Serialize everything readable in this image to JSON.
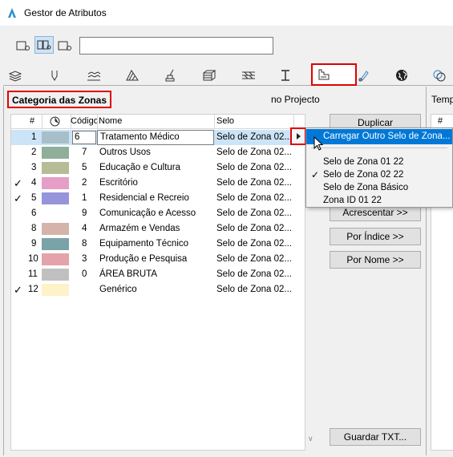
{
  "window": {
    "title": "Gestor de Atributos"
  },
  "toolbar": {
    "view_buttons": [
      "list-view-icon",
      "dual-view-icon",
      "single-view-icon"
    ],
    "search_value": ""
  },
  "tabs": [
    "stacks-icon",
    "pen-icon",
    "fill-icon",
    "surface-icon",
    "brush-icon",
    "composite-icon",
    "profile-icon",
    "column-icon",
    "zone-icon",
    "marker-icon",
    "globe-icon",
    "link-icon"
  ],
  "left_section": {
    "title": "Categoria das Zonas"
  },
  "project_label": "no Projecto",
  "template_label": "Temp",
  "table": {
    "headers": {
      "index": "#",
      "color": "",
      "code": "Código",
      "name": "Nome",
      "stamp": "Selo"
    },
    "rows": [
      {
        "index": "1",
        "checked": false,
        "color": "#a7bfc8",
        "code": "6",
        "name": "Tratamento Médico",
        "stamp": "Selo de Zona 02...",
        "selected": true
      },
      {
        "index": "2",
        "checked": false,
        "color": "#8faf9a",
        "code": "7",
        "name": "Outros Usos",
        "stamp": "Selo de Zona 02..."
      },
      {
        "index": "3",
        "checked": false,
        "color": "#b5bc96",
        "code": "5",
        "name": "Educação e Cultura",
        "stamp": "Selo de Zona 02..."
      },
      {
        "index": "4",
        "checked": true,
        "color": "#e59fc6",
        "code": "2",
        "name": "Escritório",
        "stamp": "Selo de Zona 02..."
      },
      {
        "index": "5",
        "checked": true,
        "color": "#9695db",
        "code": "1",
        "name": "Residencial e Recreio",
        "stamp": "Selo de Zona 02..."
      },
      {
        "index": "6",
        "checked": false,
        "color": "#ffffff",
        "code": "9",
        "name": "Comunicação e Acesso",
        "stamp": "Selo de Zona 02..."
      },
      {
        "index": "8",
        "checked": false,
        "color": "#d4b4aa",
        "code": "4",
        "name": "Armazém e Vendas",
        "stamp": "Selo de Zona 02..."
      },
      {
        "index": "9",
        "checked": false,
        "color": "#7aa3a8",
        "code": "8",
        "name": "Equipamento Técnico",
        "stamp": "Selo de Zona 02..."
      },
      {
        "index": "10",
        "checked": false,
        "color": "#e3a3a8",
        "code": "3",
        "name": "Produção e Pesquisa",
        "stamp": "Selo de Zona 02..."
      },
      {
        "index": "11",
        "checked": false,
        "color": "#c0c0c0",
        "code": "0",
        "name": "ÁREA BRUTA",
        "stamp": "Selo de Zona 02..."
      },
      {
        "index": "12",
        "checked": true,
        "color": "#fdf2c8",
        "code": "",
        "name": "Genérico",
        "stamp": "Selo de Zona 02..."
      }
    ]
  },
  "buttons": {
    "duplicate": "Duplicar",
    "append": "Acrescentar >>",
    "by_index": "Por Índice >>",
    "by_name": "Por Nome >>",
    "save_txt": "Guardar TXT..."
  },
  "right_table": {
    "index_header": "#"
  },
  "popup_menu": {
    "load_other": "Carregar Outro Selo de Zona...",
    "items": [
      {
        "label": "Selo de Zona 01 22",
        "checked": false
      },
      {
        "label": "Selo de Zona 02 22",
        "checked": true
      },
      {
        "label": "Selo de Zona Básico",
        "checked": false
      },
      {
        "label": "Zona ID 01 22",
        "checked": false
      }
    ]
  }
}
